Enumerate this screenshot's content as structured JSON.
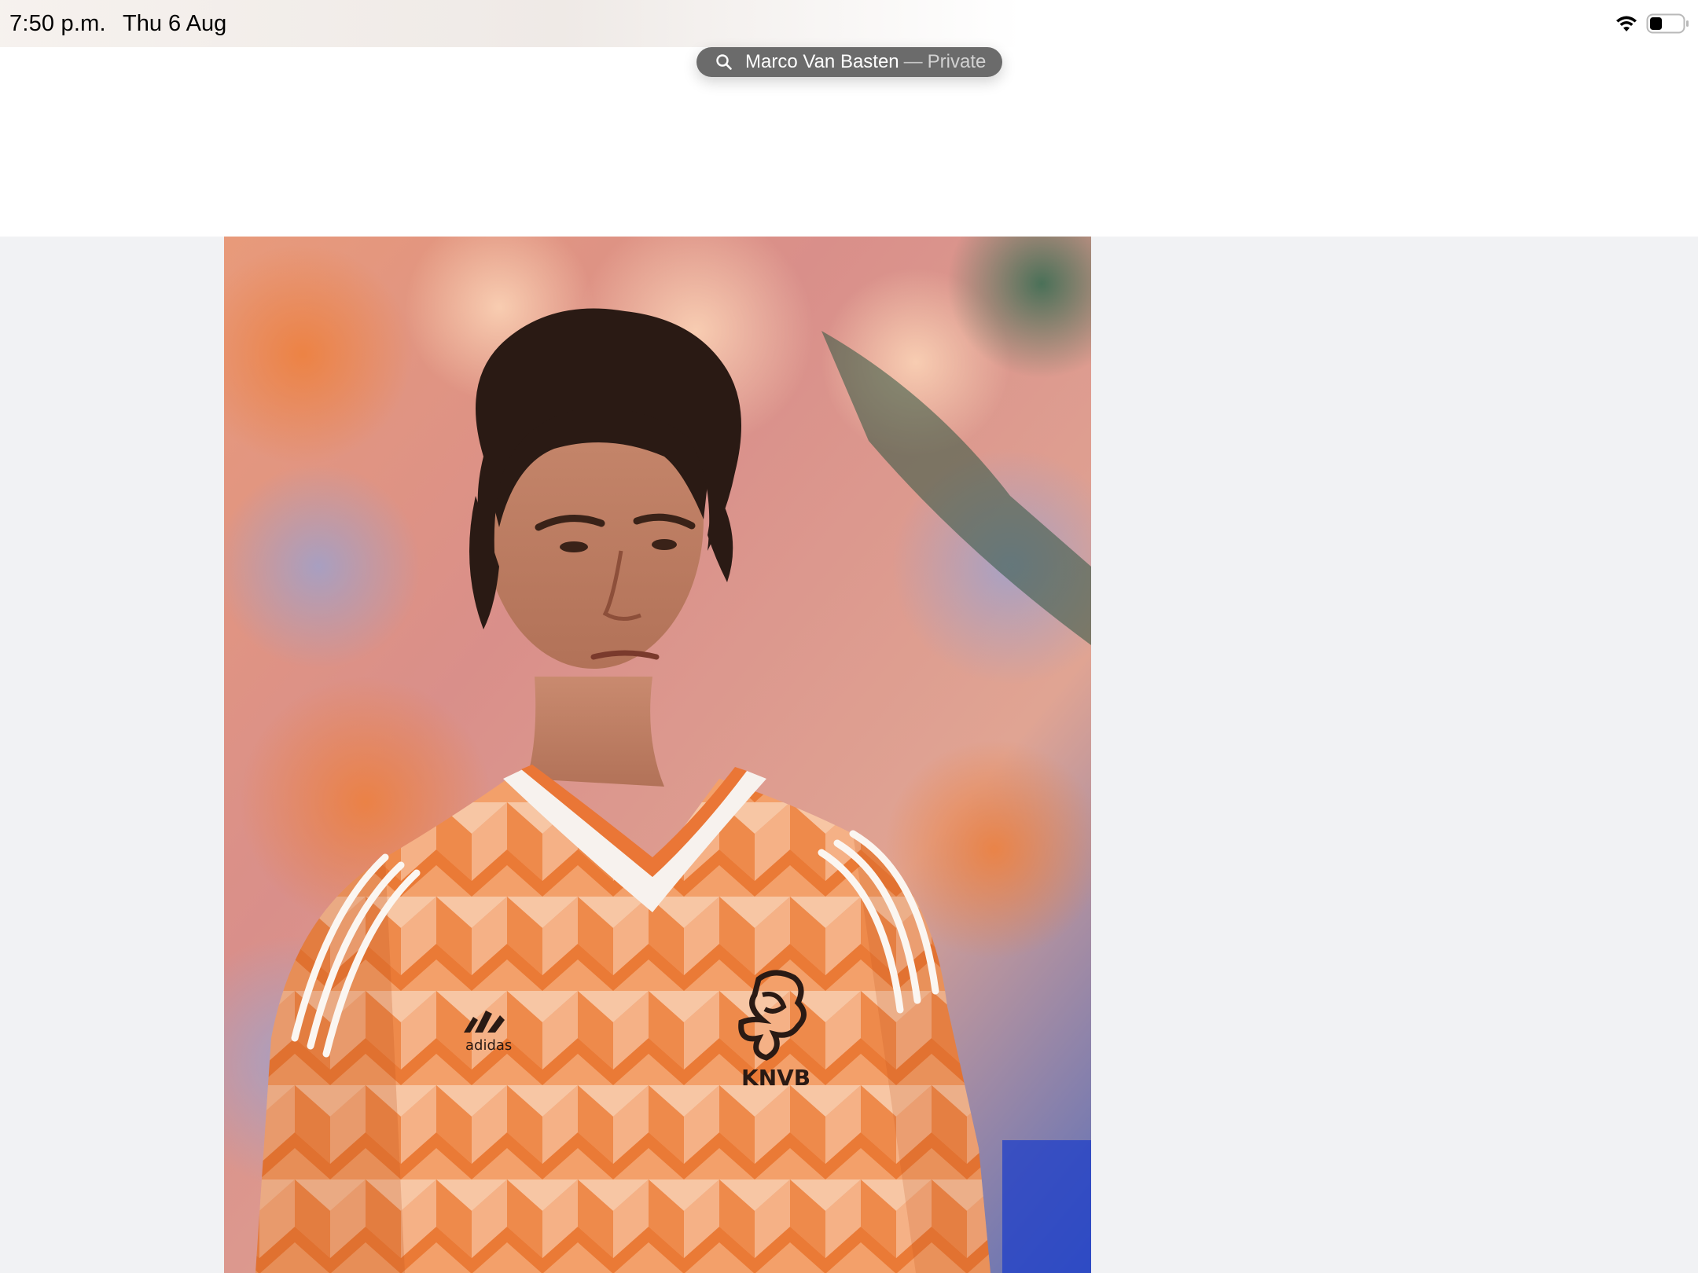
{
  "status_bar": {
    "time": "7:50 p.m.",
    "date": "Thu 6 Aug",
    "icons": [
      "wifi-icon",
      "battery-icon"
    ]
  },
  "address_bar": {
    "query": "Marco Van Basten",
    "separator": "—",
    "mode": "Private",
    "icon": "search-icon"
  },
  "image": {
    "description_icon": "photo",
    "badge_text": "KNVB",
    "brand_text": "adidas"
  },
  "colors": {
    "page_background": "#f1f2f4",
    "pill_background": "#6b6b6b",
    "shirt_orange": "#f08a3c"
  }
}
